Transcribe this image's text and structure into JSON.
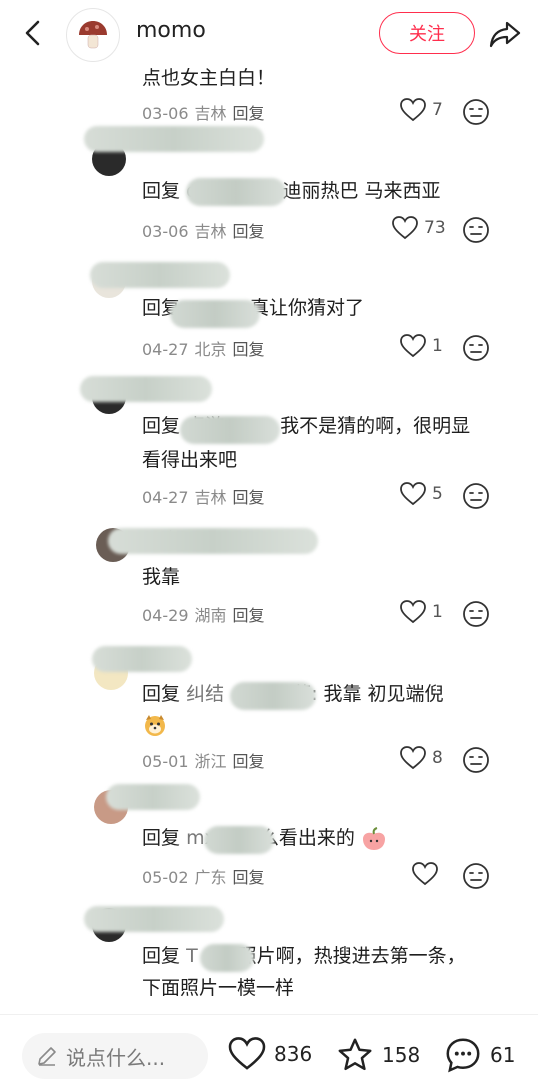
{
  "header": {
    "app_name": "momo",
    "follow_label": "关注"
  },
  "comments": [
    {
      "text_partial": "点也女主白白！",
      "date": "03-06",
      "location": "吉林",
      "reply_label": "回复",
      "likes": "7"
    },
    {
      "prefix": "回复",
      "handle": "c",
      "body": "迪丽热巴  马来西亚",
      "date": "03-06",
      "location": "吉林",
      "reply_label": "回复",
      "likes": "73"
    },
    {
      "prefix": "回复",
      "handle": "mxc",
      "body": "真让你猜对了",
      "date": "04-27",
      "location": "北京",
      "reply_label": "回复",
      "likes": "1"
    },
    {
      "prefix": "回复",
      "handle": "卓游",
      "body": "我不是猜的啊，很明显",
      "body_line2": "看得出来吧",
      "date": "04-27",
      "location": "吉林",
      "reply_label": "回复",
      "likes": "5"
    },
    {
      "name_partial": "纠结",
      "body": "我靠",
      "date": "04-29",
      "location": "湖南",
      "reply_label": "回复",
      "likes": "1"
    },
    {
      "prefix": "回复",
      "handle": "纠结",
      "body": "菜: 我靠 初见端倪",
      "date": "05-01",
      "location": "浙江",
      "reply_label": "回复",
      "likes": "8"
    },
    {
      "prefix": "回复",
      "handle": "mx",
      "body": "么看出来的",
      "date": "05-02",
      "location": "广东",
      "reply_label": "回复",
      "likes": ""
    },
    {
      "prefix": "回复",
      "handle": "T",
      "body": "照片啊，热搜进去第一条，",
      "body_line2": "下面照片一模一样"
    }
  ],
  "bottom_bar": {
    "input_placeholder": "说点什么...",
    "likes": "836",
    "stars": "158",
    "comments": "61"
  },
  "colors": {
    "accent": "#ff2e4d",
    "meta_text": "#8a8a8a"
  }
}
